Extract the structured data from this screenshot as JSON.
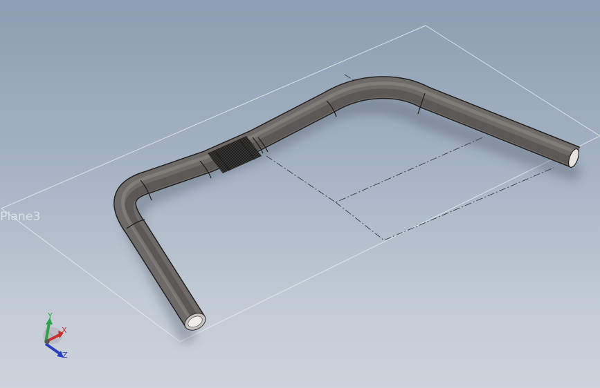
{
  "viewport": {
    "plane_label": "Plane3",
    "colors": {
      "background_top": "#8d9eb2",
      "background_bottom": "#ccd3db",
      "tube": "#6d6a67",
      "plane_outline": "#e6ebf0"
    }
  },
  "triad": {
    "x_label": "X",
    "y_label": "Y",
    "z_label": "Z",
    "colors": {
      "x": "#c83030",
      "y": "#2fa34a",
      "z": "#2a3fc0"
    }
  }
}
